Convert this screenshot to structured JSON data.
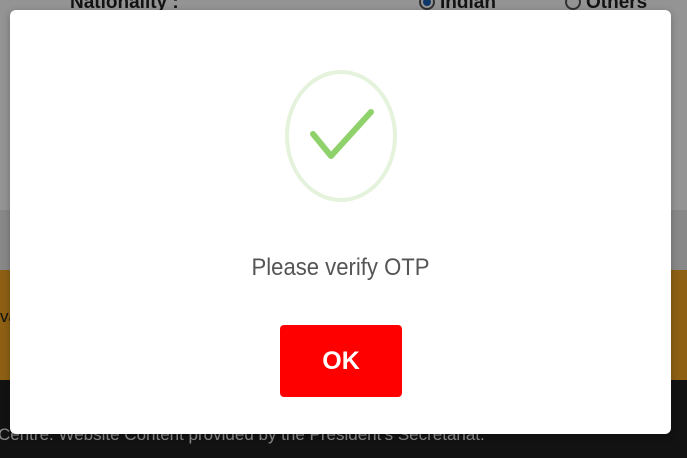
{
  "background": {
    "nationality_label": "Nationality :",
    "option_indian": "Indian",
    "option_others": "Others",
    "side_text": "va",
    "footer_text": "Centre. Website Content provided by the President's Secretariat."
  },
  "modal": {
    "icon": "checkmark-icon",
    "message": "Please verify OTP",
    "ok_label": "OK"
  },
  "colors": {
    "ok_button": "#ff0000",
    "checkmark": "#8fd16a",
    "icon_ring": "#e5f2dc"
  }
}
